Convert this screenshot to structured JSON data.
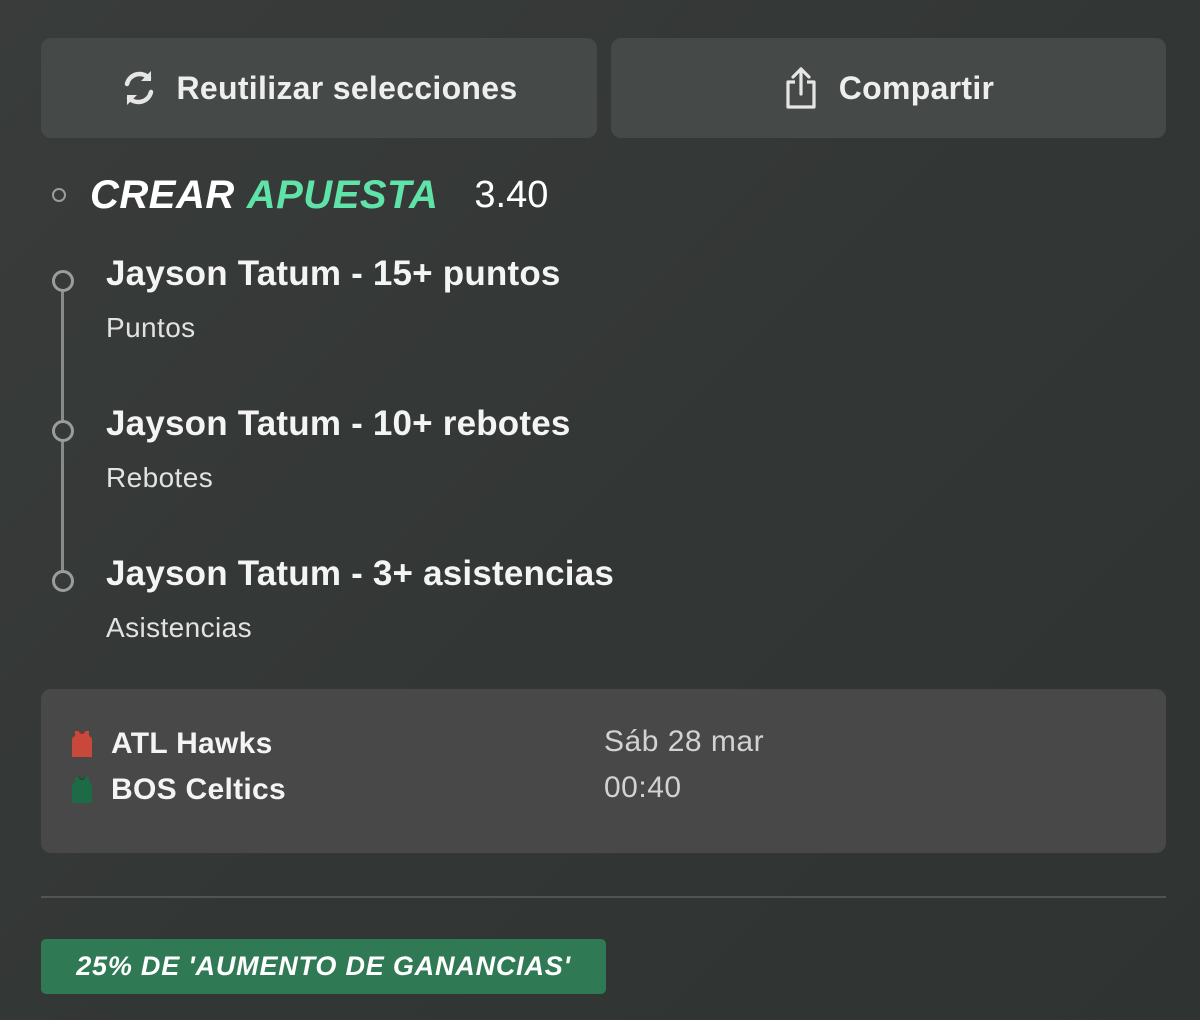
{
  "actions": {
    "reuse": {
      "label": "Reutilizar selecciones",
      "icon": "refresh-icon"
    },
    "share": {
      "label": "Compartir",
      "icon": "share-icon"
    }
  },
  "bet": {
    "title_part1": "CREAR",
    "title_part2": "APUESTA",
    "odds": "3.40"
  },
  "selections": [
    {
      "title": "Jayson Tatum - 15+ puntos",
      "market": "Puntos"
    },
    {
      "title": "Jayson Tatum - 10+ rebotes",
      "market": "Rebotes"
    },
    {
      "title": "Jayson Tatum - 3+ asistencias",
      "market": "Asistencias"
    }
  ],
  "event": {
    "home": {
      "name": "ATL Hawks",
      "jersey_color": "#c8493c"
    },
    "away": {
      "name": "BOS Celtics",
      "jersey_color": "#1d6a47"
    },
    "date": "Sáb 28 mar",
    "time": "00:40"
  },
  "promo": {
    "label": "25% DE 'AUMENTO DE GANANCIAS'"
  },
  "colors": {
    "accent": "#5fe3a9",
    "background": "#363a38",
    "button": "#454947",
    "card": "#484848",
    "promo": "#2f7a55"
  }
}
